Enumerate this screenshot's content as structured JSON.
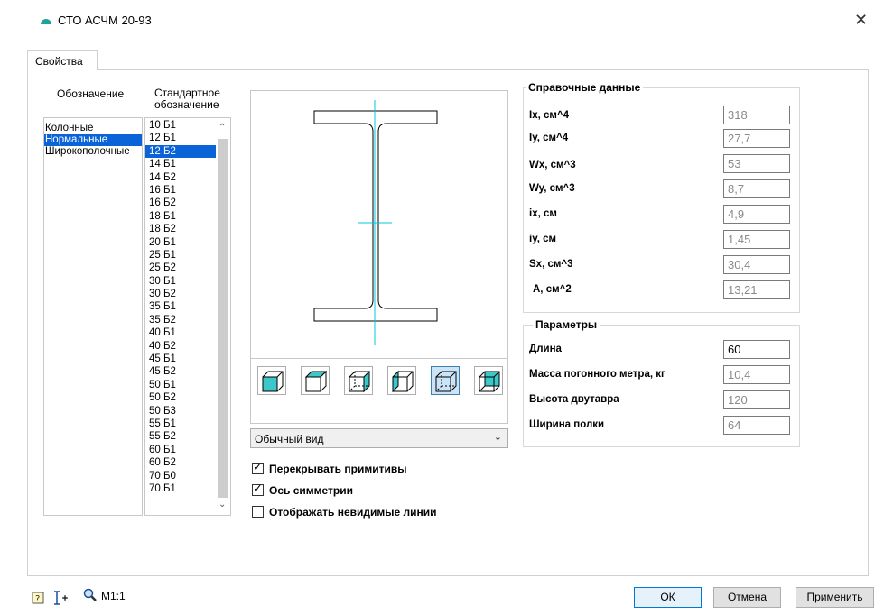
{
  "window": {
    "title": "СТО АСЧМ 20-93",
    "close_glyph": "✕",
    "icon": "app-logo-icon",
    "accent": "#1ba39c"
  },
  "tabs": [
    {
      "label": "Свойства",
      "active": true
    }
  ],
  "left": {
    "designation_header": "Обозначение",
    "standard_header": "Стандартное обозначение",
    "designations": [
      "Колонные",
      "Нормальные",
      "Широкополочные"
    ],
    "designation_selected": 1,
    "standards": [
      "10 Б1",
      "12 Б1",
      "12 Б2",
      "14 Б1",
      "14 Б2",
      "16 Б1",
      "16 Б2",
      "18 Б1",
      "18 Б2",
      "20 Б1",
      "25 Б1",
      "25 Б2",
      "30 Б1",
      "30 Б2",
      "35 Б1",
      "35 Б2",
      "40 Б1",
      "40 Б2",
      "45 Б1",
      "45 Б2",
      "50 Б1",
      "50 Б2",
      "50 Б3",
      "55 Б1",
      "55 Б2",
      "60 Б1",
      "60 Б2",
      "70 Б0",
      "70 Б1"
    ],
    "standard_selected": 2,
    "selection_color": "#0a64d7"
  },
  "view": {
    "view_buttons": [
      "view-front-icon",
      "view-top-icon",
      "view-right-icon",
      "view-left-icon",
      "view-iso-icon",
      "view-back-icon"
    ],
    "active_view": 4,
    "view_mode": "Обычный вид",
    "profile_color": "#000000",
    "axis_color": "#00c8d8",
    "checkboxes": [
      {
        "label": "Перекрывать примитивы",
        "checked": true
      },
      {
        "label": "Ось симметрии",
        "checked": true
      },
      {
        "label": "Отображать невидимые линии",
        "checked": false
      }
    ]
  },
  "reference": {
    "title": "Справочные данные",
    "rows": [
      {
        "label": "Ix, см^4",
        "value": "318"
      },
      {
        "label": "Iy, см^4",
        "value": "27,7"
      },
      {
        "label": "Wx, см^3",
        "value": "53"
      },
      {
        "label": "Wy, см^3",
        "value": "8,7"
      },
      {
        "label": "ix, см",
        "value": "4,9"
      },
      {
        "label": "iy, см",
        "value": "1,45"
      },
      {
        "label": "Sx, см^3",
        "value": "30,4"
      },
      {
        "label": "A, см^2",
        "value": "13,21"
      }
    ]
  },
  "parameters": {
    "title": "Параметры",
    "rows": [
      {
        "label": "Длина",
        "value": "60",
        "editable": true
      },
      {
        "label": "Масса погонного метра, кг",
        "value": "10,4",
        "editable": false
      },
      {
        "label": "Высота двутавра",
        "value": "120",
        "editable": false
      },
      {
        "label": "Ширина полки",
        "value": "64",
        "editable": false
      }
    ]
  },
  "footer": {
    "scale": "M1:1",
    "ok": "ОК",
    "cancel": "Отмена",
    "apply": "Применить"
  }
}
